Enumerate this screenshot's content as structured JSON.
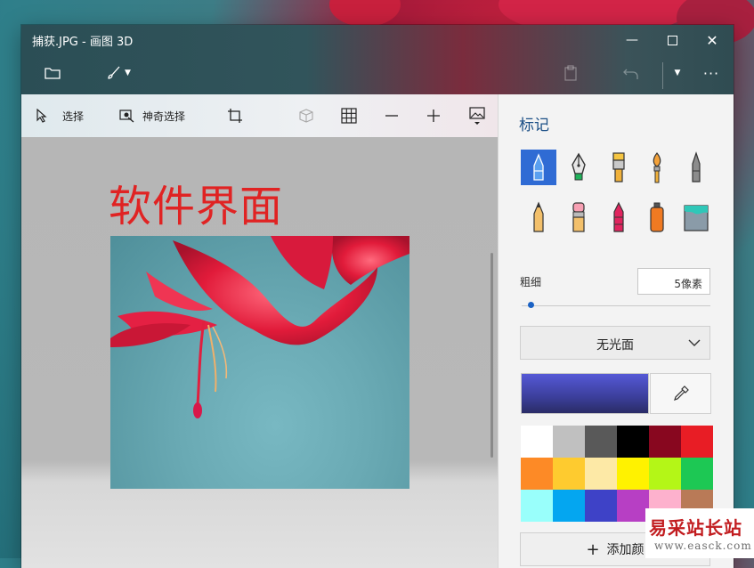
{
  "window": {
    "title": "捕获.JPG - 画图 3D"
  },
  "titlebar": {
    "icons": [
      "folder-icon",
      "brush-menu-icon",
      "paste-icon",
      "undo-icon",
      "history-menu-icon",
      "more-icon"
    ]
  },
  "toolbar": {
    "select_label": "选择",
    "magic_select_label": "神奇选择"
  },
  "canvas": {
    "heading": "软件界面"
  },
  "panel": {
    "title": "标记",
    "thickness_label": "粗细",
    "thickness_value": "5像素",
    "thickness_fraction": 0.05,
    "finish": "无光面",
    "current_color": "#3b3e9a",
    "add_color_label": "添加颜"
  },
  "palette": [
    "#ffffff",
    "#c0c0c0",
    "#595959",
    "#000000",
    "#88071f",
    "#e81d25",
    "#fd8a26",
    "#fecb2f",
    "#fde9a6",
    "#fff200",
    "#b4f617",
    "#1dc854",
    "#99fffb",
    "#04a6f0",
    "#3e42c7",
    "#b73fc4",
    "#fdb1cd",
    "#b97a57"
  ],
  "watermark": {
    "main": "易采站长站",
    "sub": "www.easck.com"
  }
}
